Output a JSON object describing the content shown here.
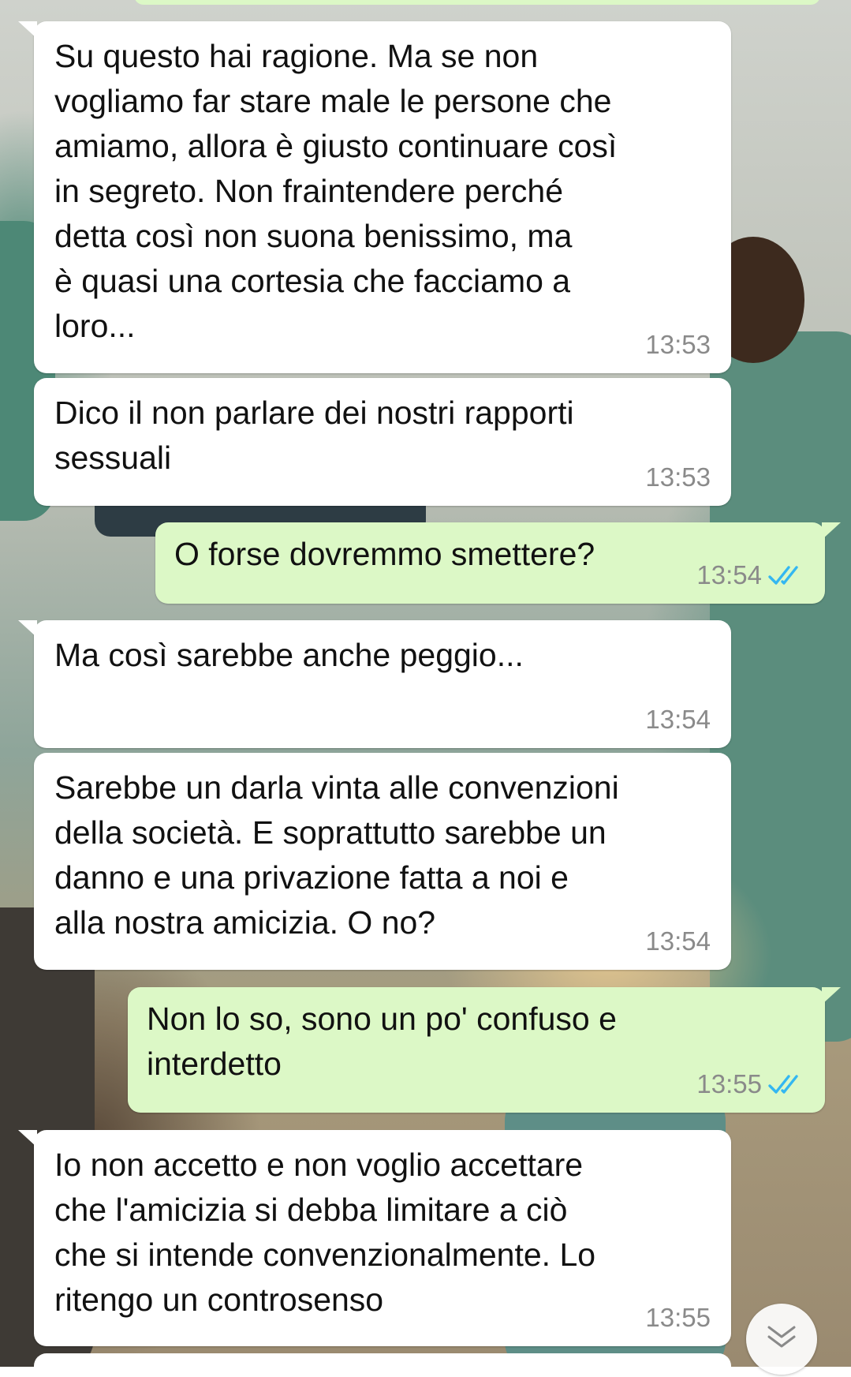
{
  "messages": [
    {
      "direction": "in",
      "text": "Su questo hai ragione. Ma se non\nvogliamo far stare male le persone che\namiamo, allora è giusto continuare così\nin segreto. Non fraintendere perché\ndetta così non suona benissimo, ma\nè quasi una cortesia che facciamo a\nloro...",
      "time": "13:53"
    },
    {
      "direction": "in",
      "text": "Dico il non parlare dei nostri rapporti\nsessuali",
      "time": "13:53"
    },
    {
      "direction": "out",
      "text": "O forse dovremmo smettere?",
      "time": "13:54",
      "status": "read"
    },
    {
      "direction": "in",
      "text": "Ma così sarebbe anche peggio...",
      "time": "13:54"
    },
    {
      "direction": "in",
      "text": "Sarebbe un darla vinta alle convenzioni\ndella società. E soprattutto sarebbe un\ndanno e una privazione fatta a noi e\nalla nostra amicizia. O no?",
      "time": "13:54"
    },
    {
      "direction": "out",
      "text": "Non lo so, sono un po' confuso e\ninterdetto",
      "time": "13:55",
      "status": "read"
    },
    {
      "direction": "in",
      "text": "Io non accetto e non voglio accettare\nche l'amicizia si debba limitare a ciò\nche si intende convenzionalmente. Lo\nritengo un controsenso",
      "time": "13:55"
    }
  ],
  "icons": {
    "read_receipt": "double-check-icon",
    "scroll_down": "chevron-double-down-icon"
  },
  "colors": {
    "incoming_bubble": "#ffffff",
    "outgoing_bubble": "#dcf8c6",
    "read_tick": "#34b7f1",
    "timestamp": "#8a8a8a"
  }
}
